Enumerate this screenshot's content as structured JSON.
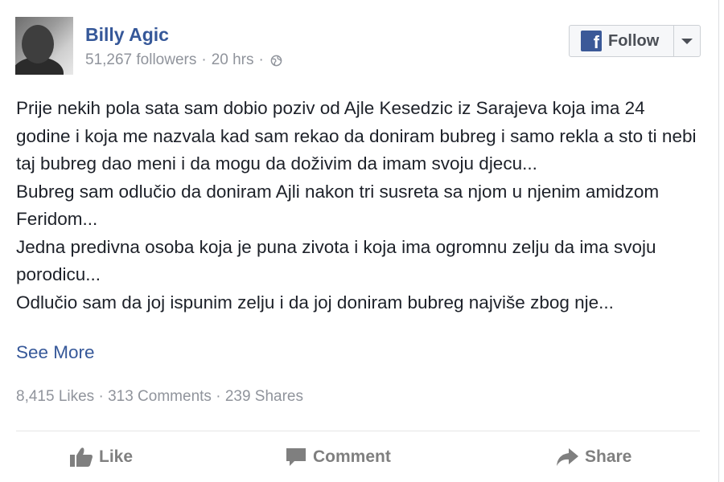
{
  "post": {
    "author": "Billy Agic",
    "followers": "51,267 followers",
    "time": "20 hrs",
    "follow_label": "Follow",
    "paragraphs": [
      "Prije nekih pola sata sam dobio poziv od Ajle Kesedzic iz Sarajeva koja ima 24 godine i koja me nazvala kad sam rekao da doniram bubreg i samo rekla a sto ti nebi taj bubreg dao meni i da mogu da doživim da imam svoju djecu...",
      "Bubreg sam odlučio da doniram Ajli nakon tri susreta sa njom u njenim amidzom Feridom...",
      "Jedna predivna osoba koja je puna zivota i koja ima ogromnu zelju da ima svoju porodicu...",
      "Odlučio sam da joj ispunim zelju i da joj doniram bubreg najviše zbog nje..."
    ],
    "see_more": "See More",
    "stats": {
      "likes": "8,415 Likes",
      "comments": "313 Comments",
      "shares": "239 Shares"
    },
    "actions": {
      "like": "Like",
      "comment": "Comment",
      "share": "Share"
    }
  },
  "icons": {
    "facebook_logo": "facebook-f-logo",
    "privacy": "globe-icon",
    "dropdown": "chevron-down-icon",
    "like": "thumbs-up-icon",
    "comment": "speech-bubble-icon",
    "share": "share-arrow-icon"
  },
  "colors": {
    "link_blue": "#365899",
    "facebook_blue": "#3b5998",
    "meta_gray": "#90949c",
    "text": "#1d2129"
  }
}
